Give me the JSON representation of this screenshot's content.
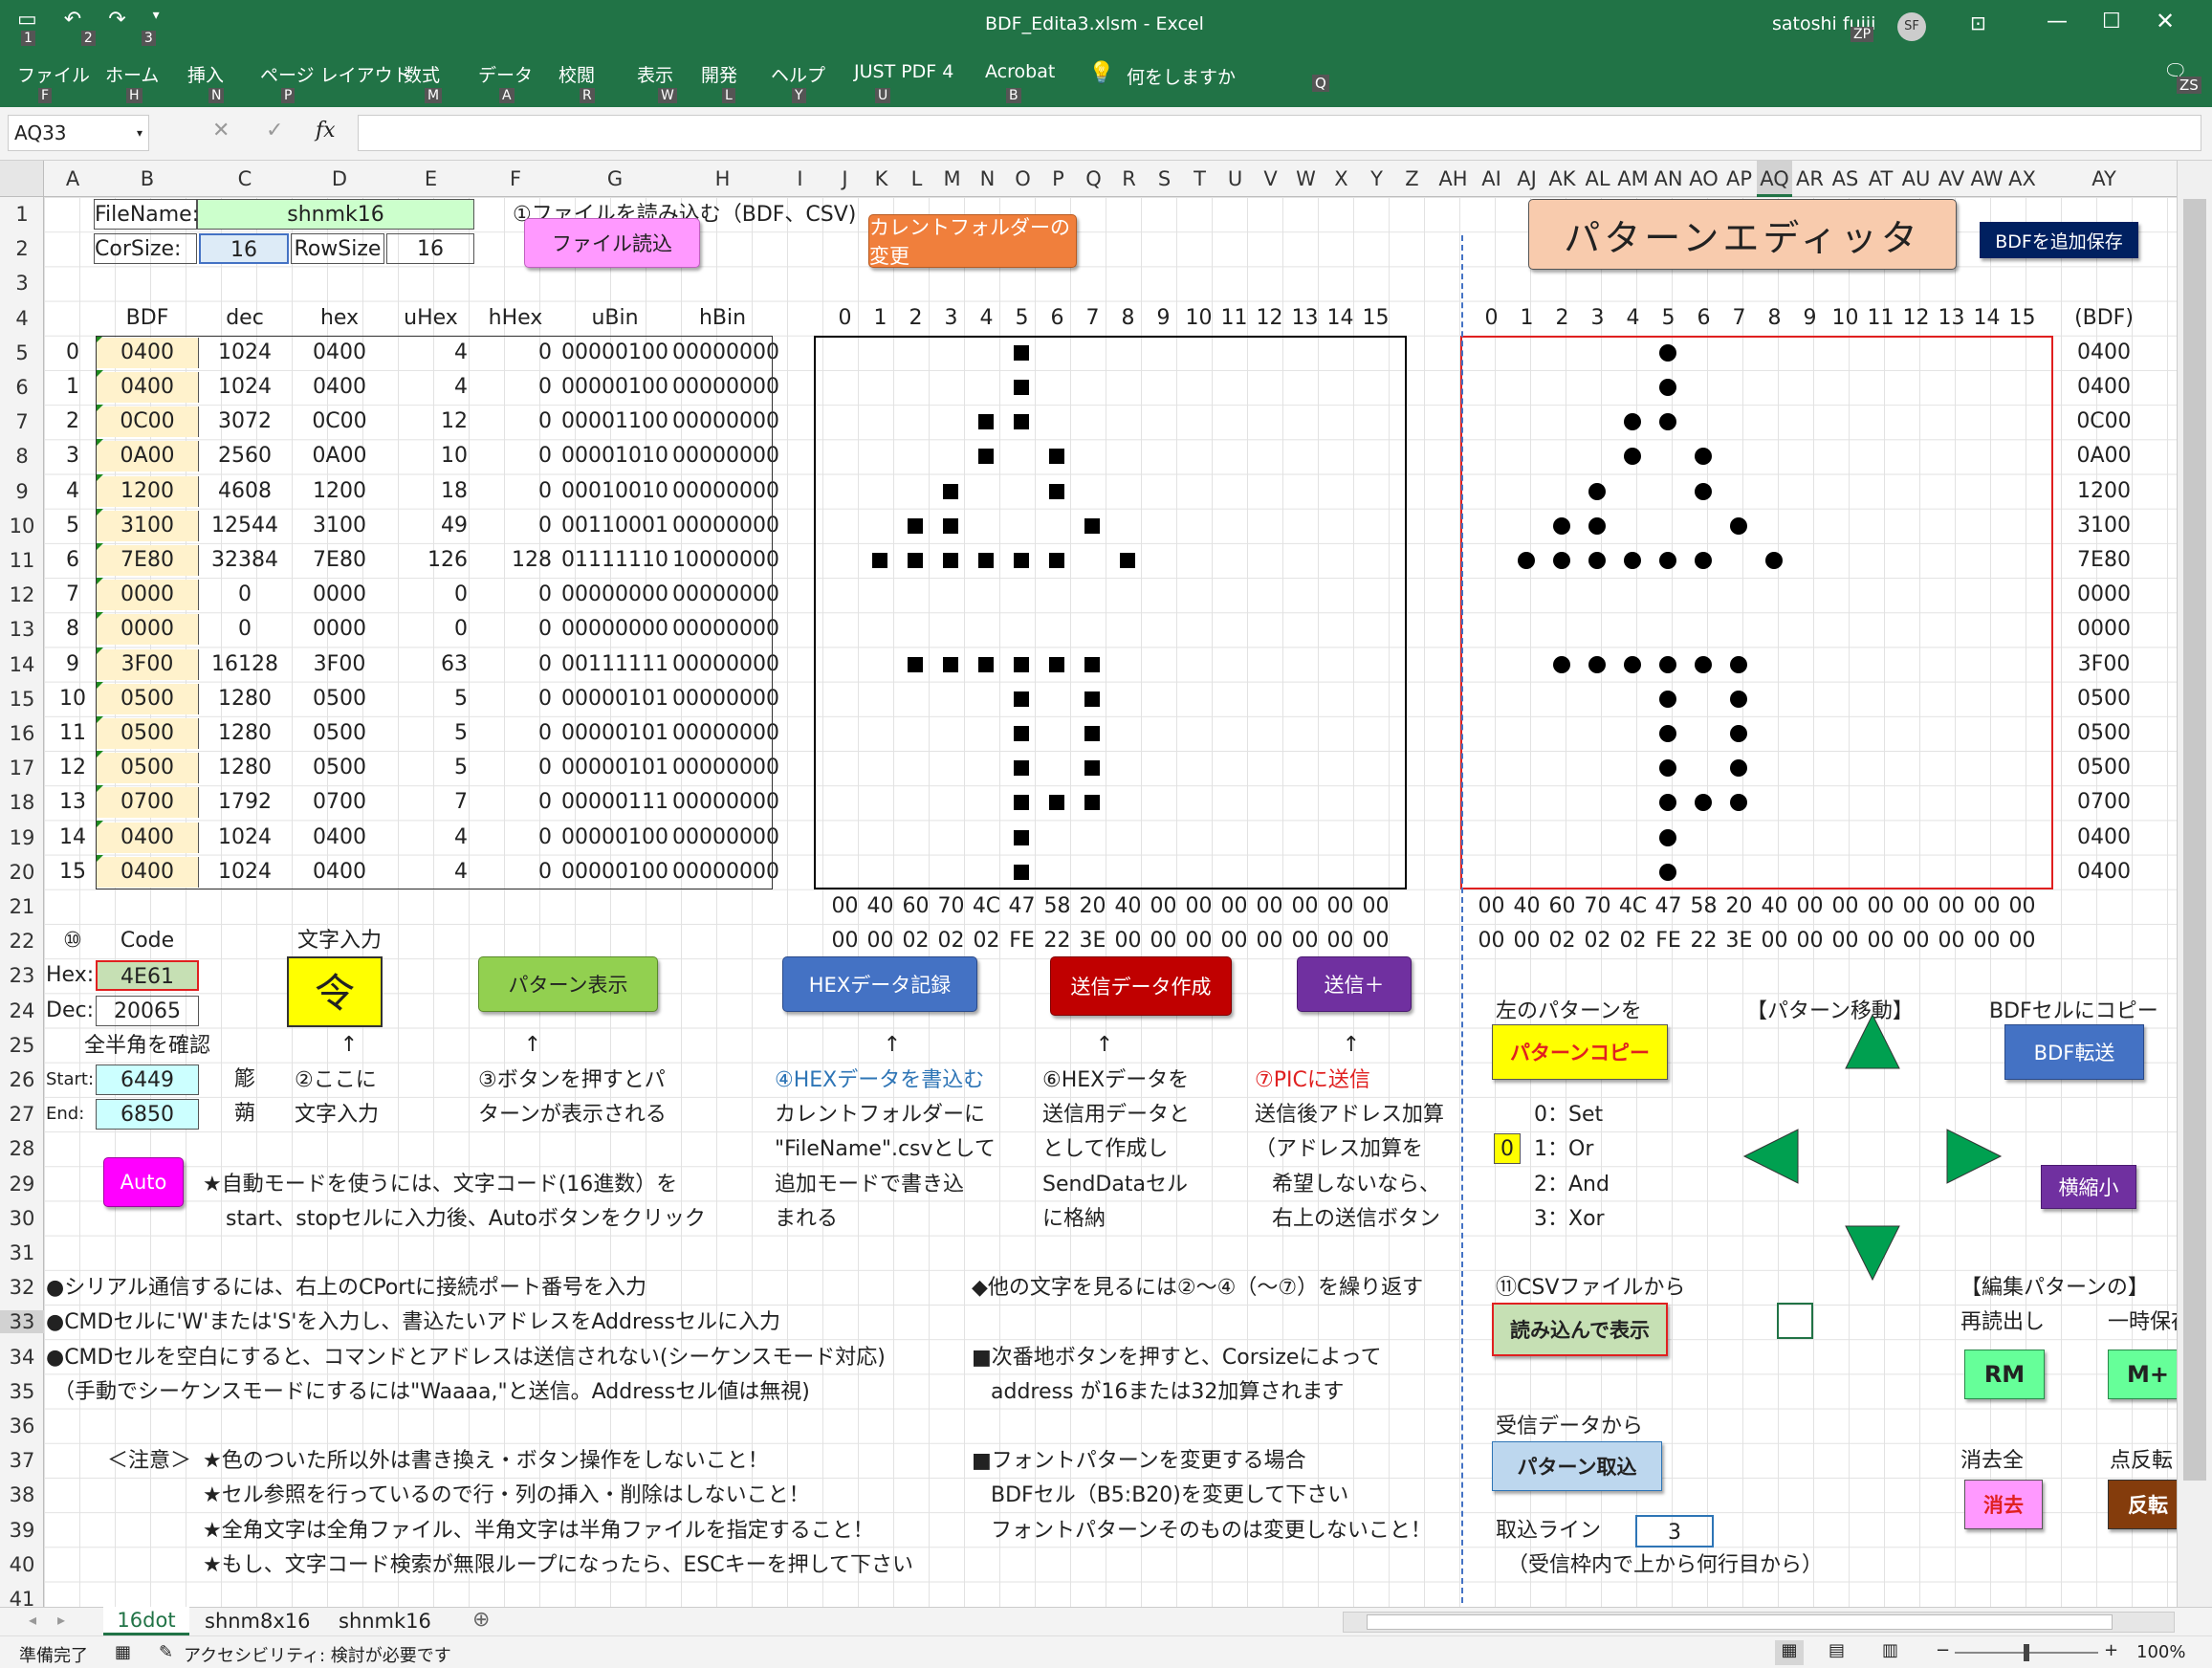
{
  "window": {
    "title": "BDF_Edita3.xlsm  -  Excel",
    "user": "satoshi fujii",
    "avatar": "SF",
    "qa_keys": [
      "1",
      "2",
      "3"
    ]
  },
  "menu": [
    {
      "label": "ファイル",
      "key": "F"
    },
    {
      "label": "ホーム",
      "key": "H"
    },
    {
      "label": "挿入",
      "key": "N"
    },
    {
      "label": "ページ レイアウト",
      "key": "P"
    },
    {
      "label": "数式",
      "key": "M"
    },
    {
      "label": "データ",
      "key": "A"
    },
    {
      "label": "校閲",
      "key": "R"
    },
    {
      "label": "表示",
      "key": "W"
    },
    {
      "label": "開発",
      "key": "L"
    },
    {
      "label": "ヘルプ",
      "key": "Y"
    },
    {
      "label": "JUST PDF 4",
      "key": "U"
    },
    {
      "label": "Acrobat",
      "key": "B"
    }
  ],
  "tellme": {
    "label": "何をしますか",
    "key": "Q"
  },
  "keytips": {
    "zp": "ZP",
    "zs": "ZS"
  },
  "formula": {
    "namebox": "AQ33",
    "fx": "fx"
  },
  "columns": [
    "A",
    "B",
    "C",
    "D",
    "E",
    "F",
    "G",
    "H",
    "I",
    "J",
    "K",
    "L",
    "M",
    "N",
    "O",
    "P",
    "Q",
    "R",
    "S",
    "T",
    "U",
    "V",
    "W",
    "X",
    "Y",
    "Z",
    "AH",
    "AI",
    "AJ",
    "AK",
    "AL",
    "AM",
    "AN",
    "AO",
    "AP",
    "AQ",
    "AR",
    "AS",
    "AT",
    "AU",
    "AV",
    "AW",
    "AX",
    "AY"
  ],
  "rows": [
    "1",
    "2",
    "3",
    "4",
    "5",
    "6",
    "7",
    "8",
    "9",
    "10",
    "11",
    "12",
    "13",
    "14",
    "15",
    "16",
    "17",
    "18",
    "19",
    "20",
    "21",
    "22",
    "23",
    "24",
    "25",
    "26",
    "27",
    "28",
    "29",
    "30",
    "31",
    "32",
    "33",
    "34",
    "35",
    "36",
    "37",
    "38",
    "39",
    "40",
    "41"
  ],
  "file": {
    "label": "FileName:",
    "value": "shnmk16",
    "cor_label": "CorSize:",
    "cor": "16",
    "row_label": "RowSize",
    "row": "16",
    "note": "①ファイルを読み込む（BDF、CSV)"
  },
  "table": {
    "headers": [
      "BDF",
      "dec",
      "hex",
      "uHex",
      "hHex",
      "uBin",
      "hBin"
    ],
    "rows": [
      [
        "0",
        "0400",
        "1024",
        "0400",
        "4",
        "0",
        "00000100",
        "00000000"
      ],
      [
        "1",
        "0400",
        "1024",
        "0400",
        "4",
        "0",
        "00000100",
        "00000000"
      ],
      [
        "2",
        "0C00",
        "3072",
        "0C00",
        "12",
        "0",
        "00001100",
        "00000000"
      ],
      [
        "3",
        "0A00",
        "2560",
        "0A00",
        "10",
        "0",
        "00001010",
        "00000000"
      ],
      [
        "4",
        "1200",
        "4608",
        "1200",
        "18",
        "0",
        "00010010",
        "00000000"
      ],
      [
        "5",
        "3100",
        "12544",
        "3100",
        "49",
        "0",
        "00110001",
        "00000000"
      ],
      [
        "6",
        "7E80",
        "32384",
        "7E80",
        "126",
        "128",
        "01111110",
        "10000000"
      ],
      [
        "7",
        "0000",
        "0",
        "0000",
        "0",
        "0",
        "00000000",
        "00000000"
      ],
      [
        "8",
        "0000",
        "0",
        "0000",
        "0",
        "0",
        "00000000",
        "00000000"
      ],
      [
        "9",
        "3F00",
        "16128",
        "3F00",
        "63",
        "0",
        "00111111",
        "00000000"
      ],
      [
        "10",
        "0500",
        "1280",
        "0500",
        "5",
        "0",
        "00000101",
        "00000000"
      ],
      [
        "11",
        "0500",
        "1280",
        "0500",
        "5",
        "0",
        "00000101",
        "00000000"
      ],
      [
        "12",
        "0500",
        "1280",
        "0500",
        "5",
        "0",
        "00000101",
        "00000000"
      ],
      [
        "13",
        "0700",
        "1792",
        "0700",
        "7",
        "0",
        "00000111",
        "00000000"
      ],
      [
        "14",
        "0400",
        "1024",
        "0400",
        "4",
        "0",
        "00000100",
        "00000000"
      ],
      [
        "15",
        "0400",
        "1024",
        "0400",
        "4",
        "0",
        "00000100",
        "00000000"
      ]
    ]
  },
  "grid_cols": [
    "0",
    "1",
    "2",
    "3",
    "4",
    "5",
    "6",
    "7",
    "8",
    "9",
    "10",
    "11",
    "12",
    "13",
    "14",
    "15"
  ],
  "bdf_rows": [
    "0400",
    "0400",
    "0C00",
    "0A00",
    "1200",
    "3100",
    "7E80",
    "0000",
    "0000",
    "3F00",
    "0500",
    "0500",
    "0500",
    "0700",
    "0400",
    "0400"
  ],
  "bdf_header": "(BDF)",
  "hex_row1": [
    "00",
    "40",
    "60",
    "70",
    "4C",
    "47",
    "58",
    "20",
    "40",
    "00",
    "00",
    "00",
    "00",
    "00",
    "00",
    "00"
  ],
  "hex_row2": [
    "00",
    "00",
    "02",
    "02",
    "02",
    "FE",
    "22",
    "3E",
    "00",
    "00",
    "00",
    "00",
    "00",
    "00",
    "00",
    "00"
  ],
  "code": {
    "circle": "⑩",
    "label": "Code",
    "hex_label": "Hex:",
    "hex": "4E61",
    "dec_label": "Dec:",
    "dec": "20065",
    "char_label": "文字入力",
    "char": "令",
    "check": "全半角を確認",
    "start_label": "Start:",
    "start": "6449",
    "start_ch": "簓",
    "end_label": "End:",
    "end": "6850",
    "end_ch": "蒴"
  },
  "buttons": {
    "read": "ファイル読込",
    "folder": "カレントフォルダーの変更",
    "editor": "パターンエディッタ",
    "bdf_save": "BDFを追加保存",
    "pattern_show": "パターン表示",
    "hex_rec": "HEXデータ記録",
    "send_make": "送信データ作成",
    "send": "送信＋",
    "copy": "パターンコピー",
    "bdf_send": "BDF転送",
    "shrink": "横縮小",
    "csv_show": "読み込んで表示",
    "rm": "RM",
    "mplus": "M+",
    "take": "パターン取込",
    "erase": "消去",
    "invert": "反転",
    "auto": "Auto"
  },
  "arrows": [
    "↑",
    "↑",
    "↑",
    "↑",
    "↑"
  ],
  "notes": {
    "n2a": "②ここに",
    "n2b": "文字入力",
    "n3a": "③ボタンを押すとパ",
    "n3b": "ターンが表示される",
    "n4a": "④HEXデータを書込む",
    "n4b": "カレントフォルダーに",
    "n4c": "\"FileName\".csvとして",
    "n4d": "追加モードで書き込",
    "n4e": "まれる",
    "n6a": "⑥HEXデータを",
    "n6b": "送信用データと",
    "n6c": "として作成し",
    "n6d": "SendDataセル",
    "n6e": "に格納",
    "n7a": "⑦PICに送信",
    "n7b": "送信後アドレス加算",
    "n7c": "（アドレス加算を",
    "n7d": "希望しないなら、",
    "n7e": "右上の送信ボタン",
    "auto1": "★自動モードを使うには、文字コード(16進数）を",
    "auto2": "start、stopセルに入力後、Autoボタンをクリック",
    "s1": "●シリアル通信するには、右上のCPortに接続ポート番号を入力",
    "s2": "●CMDセルに'W'または'S'を入力し、書込たいアドレスをAddressセルに入力",
    "s3": "●CMDセルを空白にすると、コマンドとアドレスは送信されない(シーケンスモード対応)",
    "s4": "（手動でシーケンスモードにするには\"Waaaa,\"と送信。Addressセル値は無視)",
    "r1": "◆他の文字を見るには②〜④（〜⑦）を繰り返す",
    "r2": "■次番地ボタンを押すと、Corsizeによって",
    "r3": "address が16または32加算されます",
    "r4": "■フォントパターンを変更する場合",
    "r5": "BDFセル（B5:B20)を変更して下さい",
    "r6": "フォントパターンそのものは変更しないこと！",
    "c0": "＜注意＞",
    "c1": "★色のついた所以外は書き換え・ボタン操作をしないこと！",
    "c2": "★セル参照を行っているので行・列の挿入・削除はしないこと！",
    "c3": "★全角文字は全角ファイル、半角文字は半角ファイルを指定すること！",
    "c4": "★もし、文字コード検索が無限ループになったら、ESCキーを押して下さい"
  },
  "panel": {
    "left_pattern": "左のパターンを",
    "move": "【パターン移動】",
    "bdf_copy": "BDFセルにコピー",
    "mode": "0",
    "ops": [
      "0：Set",
      "1：Or",
      "2：And",
      "3：Xor"
    ],
    "csv": "⑪CSVファイルから",
    "edit_pat": "【編集パターンの】",
    "reread": "再読出し",
    "tempsave": "一時保存",
    "recv": "受信データから",
    "clear_all": "消去全",
    "invert_pt": "点反転",
    "line_label": "取込ライン",
    "line": "3",
    "line_note": "（受信枠内で上から何行目から）"
  },
  "tabs": [
    "16dot",
    "shnm8x16",
    "shnmk16"
  ],
  "statusbar": {
    "ready": "準備完了",
    "access": "アクセシビリティ: 検討が必要です",
    "zoom": "100%"
  },
  "colors": {
    "excel_green": "#217346",
    "input_bg": "#fff2cc",
    "name_bg": "#ccffcc",
    "cyan_bg": "#ccffff"
  }
}
